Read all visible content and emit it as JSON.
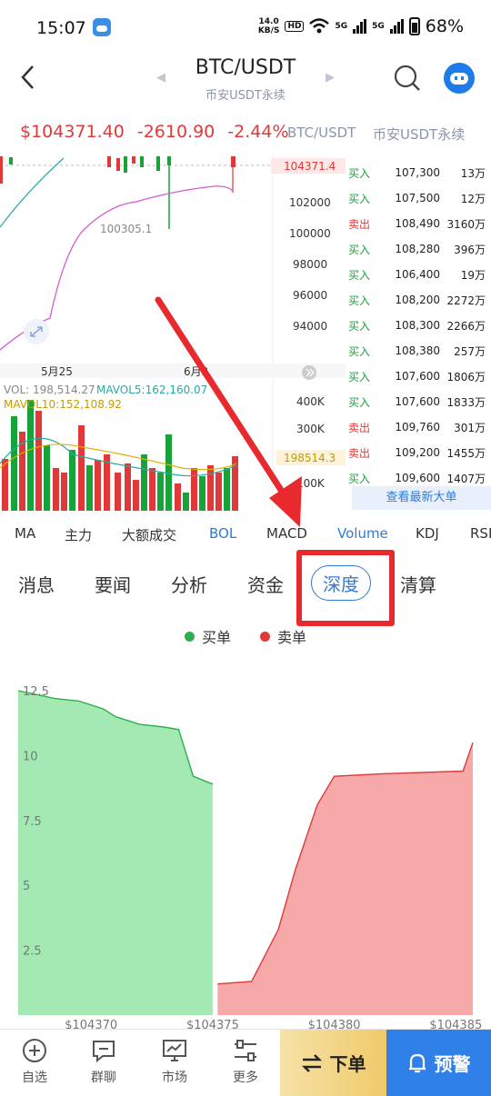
{
  "status": {
    "time": "15:07",
    "speed_top": "14.0",
    "speed_bottom": "KB/S",
    "hd": "HD",
    "net1": "5G",
    "net2": "5G",
    "battery": "68%"
  },
  "header": {
    "title": "BTC/USDT",
    "subtitle": "币安USDT永续"
  },
  "price": {
    "last": "$104371.40",
    "change": "-2610.90",
    "pct": "-2.44%",
    "pair": "BTC/USDT",
    "exchange": "币安USDT永续"
  },
  "kline": {
    "price_tag": "104371.4",
    "low_label": "100305.1",
    "y_axis": [
      "102000",
      "100000",
      "98000",
      "96000",
      "94000"
    ],
    "x_axis": [
      "5月25",
      "6月2"
    ],
    "vol_text": "VOL: 198,514.27",
    "mavol5_text": "MAVOL5:162,160.07",
    "mavol10_text": "MAVOL10:152,108.92",
    "vol_y_axis": [
      "400K",
      "300K",
      "100K"
    ],
    "vol_tag": "198514.3"
  },
  "trades": [
    {
      "type": "买入",
      "side": "buy",
      "price": "107,300",
      "qty": "13万"
    },
    {
      "type": "买入",
      "side": "buy",
      "price": "107,500",
      "qty": "12万"
    },
    {
      "type": "卖出",
      "side": "sell",
      "price": "108,490",
      "qty": "3160万"
    },
    {
      "type": "买入",
      "side": "buy",
      "price": "108,280",
      "qty": "396万"
    },
    {
      "type": "买入",
      "side": "buy",
      "price": "106,400",
      "qty": "19万"
    },
    {
      "type": "买入",
      "side": "buy",
      "price": "108,200",
      "qty": "2272万"
    },
    {
      "type": "买入",
      "side": "buy",
      "price": "108,300",
      "qty": "2266万"
    },
    {
      "type": "买入",
      "side": "buy",
      "price": "108,380",
      "qty": "257万"
    },
    {
      "type": "买入",
      "side": "buy",
      "price": "107,600",
      "qty": "1806万"
    },
    {
      "type": "买入",
      "side": "buy",
      "price": "107,600",
      "qty": "1833万"
    },
    {
      "type": "卖出",
      "side": "sell",
      "price": "109,760",
      "qty": "301万"
    },
    {
      "type": "卖出",
      "side": "sell",
      "price": "109,200",
      "qty": "1455万"
    },
    {
      "type": "买入",
      "side": "buy",
      "price": "109,600",
      "qty": "1407万"
    }
  ],
  "latest_button": "查看最新大单",
  "indicator_tabs": [
    "MA",
    "主力",
    "大额成交",
    "BOL",
    "MACD",
    "Volume",
    "KDJ",
    "RSI"
  ],
  "indicator_active": [
    "BOL",
    "Volume"
  ],
  "category_tabs": [
    "消息",
    "要闻",
    "分析",
    "资金",
    "深度",
    "清算"
  ],
  "category_active": "深度",
  "legend": {
    "buy": "买单",
    "sell": "卖单"
  },
  "colors": {
    "buy": "#18a33a",
    "sell": "#e0393a",
    "accent": "#2f7bd8",
    "buy_fill": "#a4e8b4",
    "sell_fill": "#f7a9a9"
  },
  "chart_data": {
    "type": "area",
    "x_ticks": [
      "$104370",
      "$104375",
      "$104380",
      "$104385"
    ],
    "y_ticks": [
      "2.5",
      "5",
      "7.5",
      "10",
      "12.5"
    ],
    "ylim": [
      0,
      12.5
    ],
    "series": [
      {
        "name": "买单",
        "x": [
          104367.0,
          104368.5,
          104369.5,
          104370.5,
          104371.0,
          104372.0,
          104373.0,
          104373.6,
          104374.2,
          104375.0
        ],
        "values": [
          12.5,
          12.2,
          12.1,
          11.8,
          11.5,
          11.2,
          11.1,
          11.0,
          9.2,
          8.9
        ]
      },
      {
        "name": "卖单",
        "x": [
          104375.2,
          104376.6,
          104377.7,
          104378.4,
          104379.3,
          104380.0,
          104382.0,
          104385.3,
          104385.7
        ],
        "values": [
          1.2,
          1.3,
          3.3,
          5.6,
          8.1,
          9.2,
          9.3,
          9.4,
          10.5
        ]
      }
    ]
  },
  "nav": {
    "items": [
      "自选",
      "群聊",
      "市场",
      "更多"
    ],
    "order": "下单",
    "alert": "预警"
  }
}
